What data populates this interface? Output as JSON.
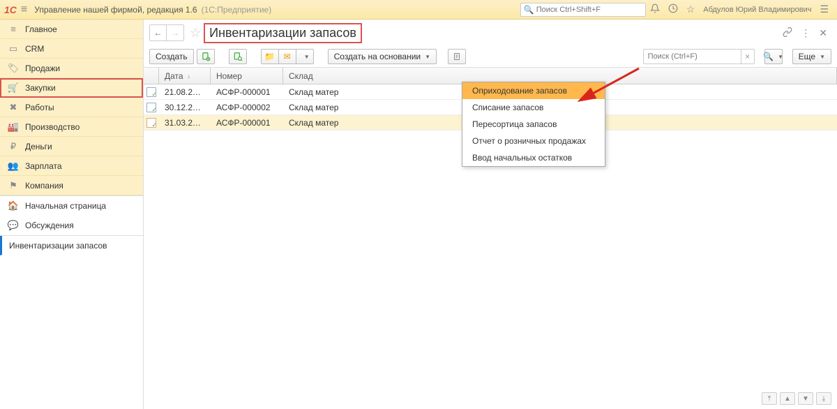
{
  "titlebar": {
    "logo": "1C",
    "title": "Управление нашей фирмой, редакция 1.6",
    "subtitle": "(1С:Предприятие)",
    "search_placeholder": "Поиск Ctrl+Shift+F",
    "user": "Абдулов Юрий Владимирович"
  },
  "sidebar": {
    "sections": [
      {
        "icon": "≡",
        "label": "Главное"
      },
      {
        "icon": "▭",
        "label": "CRM"
      },
      {
        "icon": "🏷",
        "label": "Продажи"
      },
      {
        "icon": "🛒",
        "label": "Закупки",
        "highlighted": true
      },
      {
        "icon": "✖",
        "label": "Работы"
      },
      {
        "icon": "🏭",
        "label": "Производство"
      },
      {
        "icon": "₽",
        "label": "Деньги"
      },
      {
        "icon": "👥",
        "label": "Зарплата"
      },
      {
        "icon": "⚑",
        "label": "Компания"
      }
    ],
    "bottom": [
      {
        "icon": "🏠",
        "label": "Начальная страница"
      },
      {
        "icon": "💬",
        "label": "Обсуждения"
      },
      {
        "icon": "",
        "label": "Инвентаризации запасов",
        "active": true
      }
    ]
  },
  "page": {
    "title": "Инвентаризации запасов"
  },
  "toolbar": {
    "create": "Создать",
    "create_based": "Создать на основании",
    "search_placeholder": "Поиск (Ctrl+F)",
    "more": "Еще"
  },
  "grid": {
    "headers": {
      "date": "Дата",
      "num": "Номер",
      "wh": "Склад"
    },
    "rows": [
      {
        "date": "21.08.2…",
        "num": "АСФР-000001",
        "wh": "Склад матер"
      },
      {
        "date": "30.12.2…",
        "num": "АСФР-000002",
        "wh": "Склад матер"
      },
      {
        "date": "31.03.2…",
        "num": "АСФР-000001",
        "wh": "Склад матер",
        "selected": true
      }
    ]
  },
  "dropdown": {
    "items": [
      "Оприходование запасов",
      "Списание запасов",
      "Пересортица запасов",
      "Отчет о розничных продажах",
      "Ввод начальных остатков"
    ]
  }
}
